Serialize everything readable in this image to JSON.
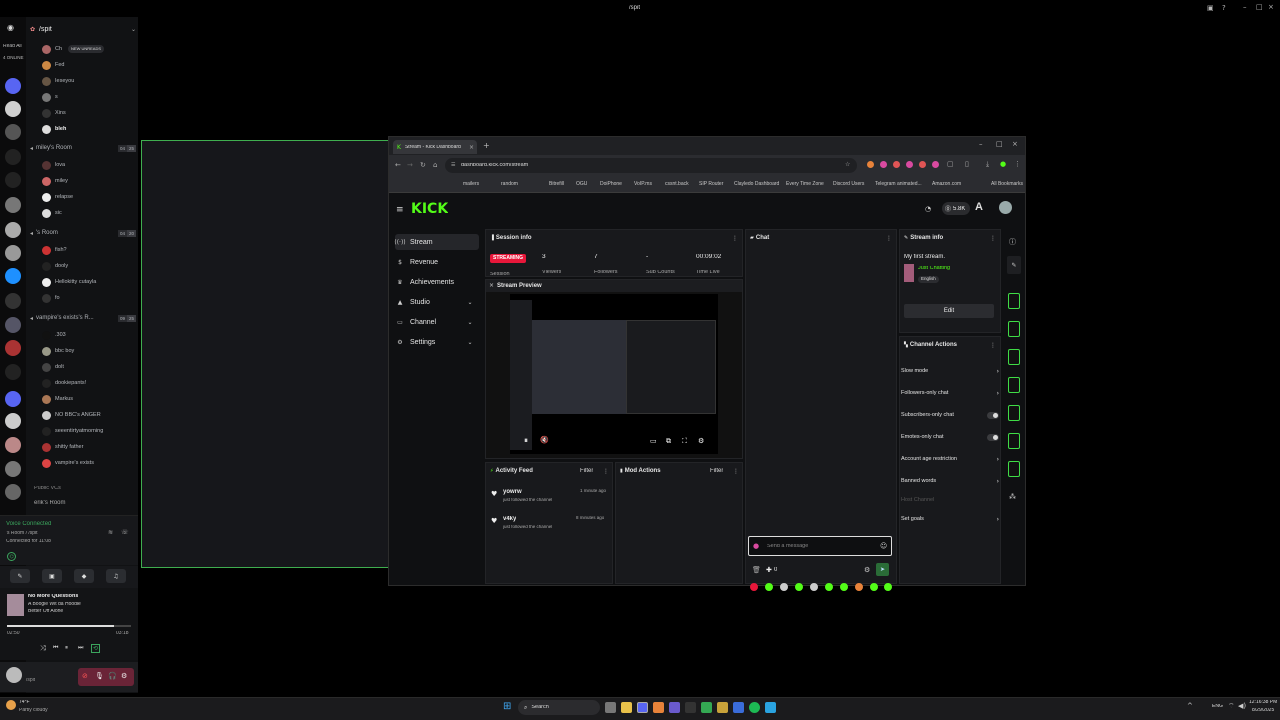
{
  "window_title": "/spit",
  "discord": {
    "channel": "/spit",
    "read_all": "Read All",
    "online": "4 ONLINE",
    "new_unreads": "NEW UNREADS",
    "members_top": [
      "Ch",
      "Fed",
      "Ieseyou",
      "s",
      "Xins",
      "bleh"
    ],
    "rooms": [
      {
        "name": "miley's Room",
        "count_a": "04",
        "count_b": "25",
        "members": [
          "lova",
          "miley",
          "relapse",
          "sic"
        ]
      },
      {
        "name": "'s Room",
        "count_a": "04",
        "count_b": "20",
        "members": [
          "fish?",
          "dooly",
          "Hellokitty cutayla",
          "fo"
        ]
      },
      {
        "name": "vampire's exists's R...",
        "count_a": "09",
        "count_b": "25",
        "members": [
          ".303",
          "bbc boy",
          "dolt",
          "dookiepants!",
          "Markus",
          "NO BBC's ANGER",
          "seeentirtyatmorning",
          "shitty father",
          "vampire's exists"
        ]
      }
    ],
    "public_vcs": "Public VCs",
    "eriks_room": "erik's Room",
    "voice_connected": "Voice Connected",
    "voice_channel": "'s Room / /spit",
    "connected_for": "Connected for 11:08",
    "music": {
      "title": "No More Questions",
      "artist": "A Boogie Wit da Hoodie",
      "album": "Better Off Alone",
      "elapsed": "02:50",
      "total": "03:18",
      "progress": 0.86
    },
    "user_status": "/spit"
  },
  "browser": {
    "tab_title": "Stream - Kick Dashboard",
    "url": "dashboard.kick.com/stream",
    "bookmarks": [
      "mailers",
      "random",
      "Bitrefill",
      "OGU",
      "DoiPhone",
      "VoIP.ms",
      "cssnt.back",
      "SIP Router",
      "Clayledo Dashboard",
      "Every Time Zone",
      "Discord Users",
      "Telegram animated...",
      "Amazon.com"
    ],
    "all_bookmarks": "All Bookmarks"
  },
  "kick": {
    "logo": "KICK",
    "followers_badge": "5.8K",
    "nav": [
      {
        "label": "Stream",
        "icon": "stream-icon"
      },
      {
        "label": "Revenue",
        "icon": "dollar-icon"
      },
      {
        "label": "Achievements",
        "icon": "trophy-icon"
      },
      {
        "label": "Studio",
        "icon": "studio-icon",
        "expandable": true
      },
      {
        "label": "Channel",
        "icon": "channel-icon",
        "expandable": true
      },
      {
        "label": "Settings",
        "icon": "gear-icon",
        "expandable": true
      }
    ],
    "session": {
      "title": "Session info",
      "status": "STREAMING",
      "session_label": "Session",
      "viewers": "3",
      "viewers_label": "Viewers",
      "followers": "7",
      "followers_label": "Followers",
      "subs": "-",
      "subs_label": "Sub Counts",
      "time": "00:09:02",
      "time_label": "Time Live"
    },
    "preview_title": "Stream Preview",
    "activity": {
      "title": "Activity Feed",
      "filter": "Filter",
      "items": [
        {
          "name": "yowrw",
          "action": "just followed the channel",
          "time": "1 minute ago"
        },
        {
          "name": "v4ky",
          "action": "just followed the channel",
          "time": "8 minutes ago"
        }
      ]
    },
    "mod": {
      "title": "Mod Actions",
      "filter": "Filter"
    },
    "chat": {
      "title": "Chat",
      "placeholder": "Send a message",
      "count": "0"
    },
    "stream_info": {
      "title": "Stream info",
      "stream_title": "My first stream.",
      "category": "Just Chatting",
      "language": "English",
      "edit": "Edit"
    },
    "channel_actions": {
      "title": "Channel Actions",
      "items": [
        {
          "label": "Slow mode",
          "control": "chevron"
        },
        {
          "label": "Followers-only chat",
          "control": "chevron"
        },
        {
          "label": "Subscribers-only chat",
          "control": "toggle"
        },
        {
          "label": "Emotes-only chat",
          "control": "toggle"
        },
        {
          "label": "Account age restriction",
          "control": "chevron"
        },
        {
          "label": "Banned words",
          "control": "chevron"
        },
        {
          "label": "Host Channel",
          "control": "none",
          "disabled": true
        },
        {
          "label": "Set goals",
          "control": "chevron"
        }
      ]
    }
  },
  "taskbar": {
    "weather_temp": "74°F",
    "weather_desc": "Partly cloudy",
    "search": "Search",
    "lang": "ENG",
    "time": "12:16:38 PM",
    "date": "8/29/2025"
  },
  "colors": {
    "kick_green": "#53fc18",
    "streaming_red": "#e8173a",
    "overlay_border": "#3fae4f"
  }
}
